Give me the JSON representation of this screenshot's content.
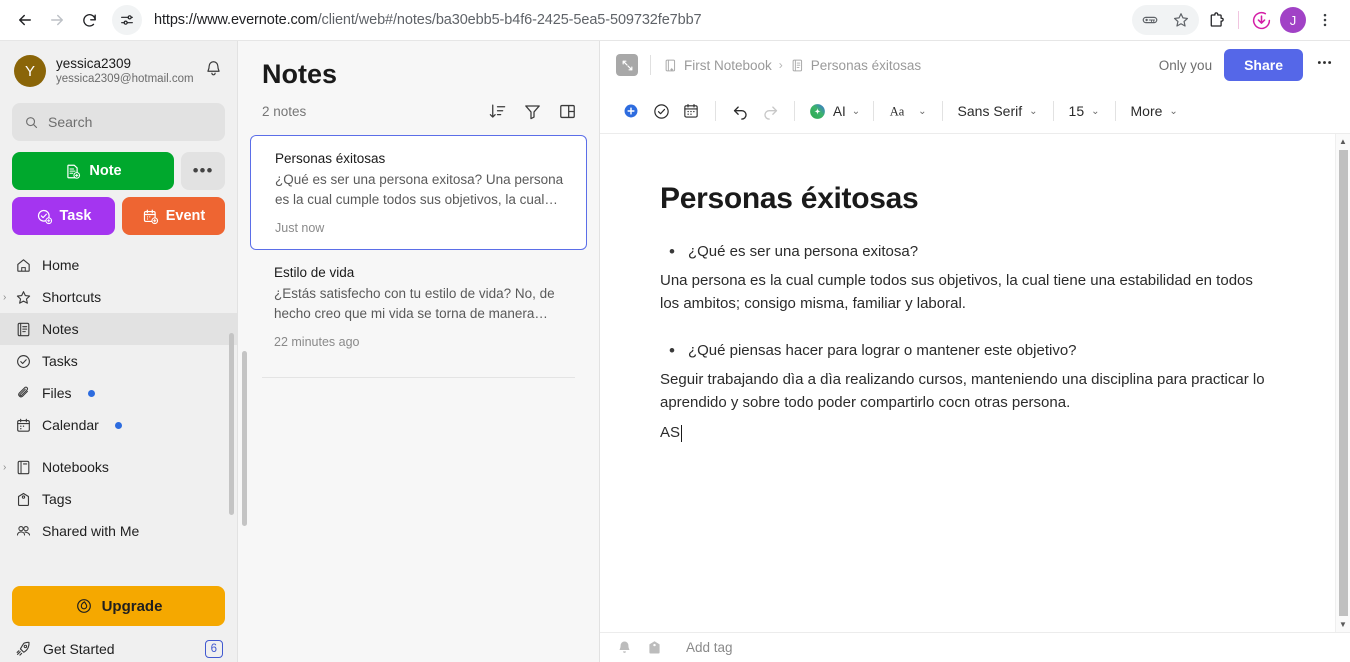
{
  "browser": {
    "url_main": "https://www.evernote.com",
    "url_rest": "/client/web#/notes/ba30ebb5-b4f6-2425-5ea5-509732fe7bb7",
    "back_icon": "back-arrow-icon",
    "forward_icon": "forward-arrow-icon",
    "reload_icon": "reload-icon",
    "site_info_icon": "site-settings-icon",
    "password_icon": "password-key-icon",
    "bookmark_icon": "star-bookmark-icon",
    "extensions_icon": "extensions-puzzle-icon",
    "download_icon": "download-icon",
    "menu_icon": "three-dot-menu-icon",
    "profile_initial": "J",
    "profile_color": "#a142c6"
  },
  "sidebar": {
    "user": {
      "name": "yessica2309",
      "email": "yessica2309@hotmail.com",
      "initial": "Y",
      "avatar_color": "#8a6508"
    },
    "notifications_icon": "bell-icon",
    "search": {
      "placeholder": "Search",
      "icon": "search-icon"
    },
    "new_note_label": "Note",
    "new_note_color": "#00a82d",
    "more_label": "•••",
    "task_label": "Task",
    "task_color": "#a435f0",
    "event_label": "Event",
    "event_color": "#ee6532",
    "items": [
      {
        "label": "Home",
        "icon": "home-icon",
        "active": false,
        "caret": false,
        "dot": false
      },
      {
        "label": "Shortcuts",
        "icon": "star-icon",
        "active": false,
        "caret": true,
        "dot": false
      },
      {
        "label": "Notes",
        "icon": "note-icon",
        "active": true,
        "caret": false,
        "dot": false
      },
      {
        "label": "Tasks",
        "icon": "check-circle-icon",
        "active": false,
        "caret": false,
        "dot": false
      },
      {
        "label": "Files",
        "icon": "paperclip-icon",
        "active": false,
        "caret": false,
        "dot": true
      },
      {
        "label": "Calendar",
        "icon": "calendar-icon",
        "active": false,
        "caret": false,
        "dot": true
      },
      {
        "label": "Notebooks",
        "icon": "notebook-icon",
        "active": false,
        "caret": true,
        "dot": false
      },
      {
        "label": "Tags",
        "icon": "tag-icon",
        "active": false,
        "caret": false,
        "dot": false
      },
      {
        "label": "Shared with Me",
        "icon": "shared-icon",
        "active": false,
        "caret": false,
        "dot": false
      }
    ],
    "upgrade_label": "Upgrade",
    "upgrade_color": "#f5a800",
    "upgrade_icon": "upgrade-badge-icon",
    "get_started_label": "Get Started",
    "get_started_icon": "rocket-icon",
    "get_started_badge": "6"
  },
  "notelist": {
    "title": "Notes",
    "count_label": "2 notes",
    "sort_icon": "sort-descending-icon",
    "filter_icon": "filter-funnel-icon",
    "view_icon": "layout-view-icon",
    "notes": [
      {
        "title": "Personas éxitosas",
        "excerpt": "¿Qué es ser una persona exitosa? Una persona es la cual cumple todos sus objetivos, la cual…",
        "time": "Just now",
        "selected": true
      },
      {
        "title": "Estilo de vida",
        "excerpt": "¿Estás satisfecho con tu estilo de vida? No, de hecho creo que mi vida se torna de manera…",
        "time": "22 minutes ago",
        "selected": false
      }
    ]
  },
  "editor": {
    "expand_icon": "expand-note-icon",
    "breadcrumb": {
      "notebook_icon": "notebook-star-icon",
      "notebook": "First Notebook",
      "separator": "›",
      "note_icon": "note-page-icon",
      "note": "Personas éxitosas"
    },
    "only_you": "Only you",
    "share_label": "Share",
    "share_color": "#5567e8",
    "more_icon": "three-dot-menu-icon",
    "toolbar": {
      "insert_icon": "plus-circle-icon",
      "task_icon": "check-circle-icon",
      "calendar_icon": "calendar-icon",
      "undo_icon": "undo-icon",
      "redo_icon": "redo-icon",
      "ai_icon": "ai-sparkle-icon",
      "ai_label": "AI",
      "format_icon": "text-format-aa-icon",
      "font_family": "Sans Serif",
      "font_size": "15",
      "more_label": "More",
      "chevron": "⌄"
    },
    "note": {
      "title": "Personas éxitosas",
      "blocks": [
        {
          "type": "bullet",
          "text": "¿Qué es ser una persona exitosa?"
        },
        {
          "type": "para",
          "text": "Una persona es la cual cumple todos sus objetivos, la cual tiene una estabilidad en todos los ambitos; consigo misma, familiar y laboral."
        },
        {
          "type": "bullet",
          "text": "¿Qué piensas hacer para lograr o mantener este objetivo?"
        },
        {
          "type": "para",
          "text": "Seguir trabajando dìa a dìa realizando cursos, manteniendo una disciplina para practicar lo aprendido y sobre todo poder compartirlo cocn otras persona."
        },
        {
          "type": "typing",
          "text": "AS"
        }
      ]
    },
    "footer": {
      "reminder_icon": "bell-filled-icon",
      "tag_icon": "tag-filled-icon",
      "add_tag_placeholder": "Add tag"
    },
    "scrollbar": {
      "up": "▲",
      "down": "▼"
    }
  }
}
